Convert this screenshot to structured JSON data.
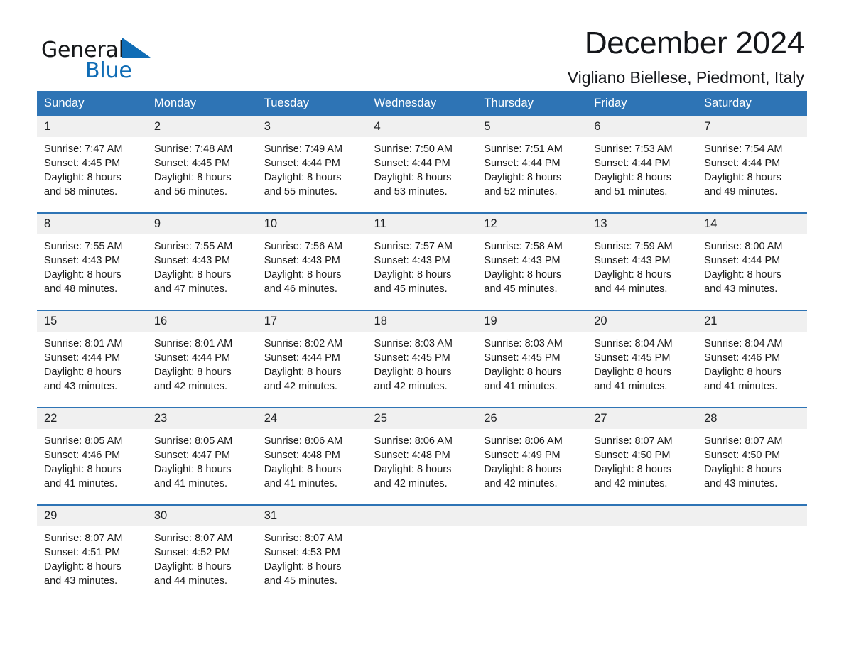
{
  "brand": {
    "name_part1": "General",
    "name_part2": "Blue"
  },
  "header": {
    "month_title": "December 2024",
    "location": "Vigliano Biellese, Piedmont, Italy"
  },
  "colors": {
    "header_blue": "#2e74b5",
    "brand_blue": "#0f6cb5",
    "daynum_strip": "#f0f0f0",
    "text": "#1a1a1a"
  },
  "calendar": {
    "weekday_headers": [
      "Sunday",
      "Monday",
      "Tuesday",
      "Wednesday",
      "Thursday",
      "Friday",
      "Saturday"
    ],
    "weeks": [
      [
        {
          "day": "1",
          "sunrise": "Sunrise: 7:47 AM",
          "sunset": "Sunset: 4:45 PM",
          "daylight_line1": "Daylight: 8 hours",
          "daylight_line2": "and 58 minutes."
        },
        {
          "day": "2",
          "sunrise": "Sunrise: 7:48 AM",
          "sunset": "Sunset: 4:45 PM",
          "daylight_line1": "Daylight: 8 hours",
          "daylight_line2": "and 56 minutes."
        },
        {
          "day": "3",
          "sunrise": "Sunrise: 7:49 AM",
          "sunset": "Sunset: 4:44 PM",
          "daylight_line1": "Daylight: 8 hours",
          "daylight_line2": "and 55 minutes."
        },
        {
          "day": "4",
          "sunrise": "Sunrise: 7:50 AM",
          "sunset": "Sunset: 4:44 PM",
          "daylight_line1": "Daylight: 8 hours",
          "daylight_line2": "and 53 minutes."
        },
        {
          "day": "5",
          "sunrise": "Sunrise: 7:51 AM",
          "sunset": "Sunset: 4:44 PM",
          "daylight_line1": "Daylight: 8 hours",
          "daylight_line2": "and 52 minutes."
        },
        {
          "day": "6",
          "sunrise": "Sunrise: 7:53 AM",
          "sunset": "Sunset: 4:44 PM",
          "daylight_line1": "Daylight: 8 hours",
          "daylight_line2": "and 51 minutes."
        },
        {
          "day": "7",
          "sunrise": "Sunrise: 7:54 AM",
          "sunset": "Sunset: 4:44 PM",
          "daylight_line1": "Daylight: 8 hours",
          "daylight_line2": "and 49 minutes."
        }
      ],
      [
        {
          "day": "8",
          "sunrise": "Sunrise: 7:55 AM",
          "sunset": "Sunset: 4:43 PM",
          "daylight_line1": "Daylight: 8 hours",
          "daylight_line2": "and 48 minutes."
        },
        {
          "day": "9",
          "sunrise": "Sunrise: 7:55 AM",
          "sunset": "Sunset: 4:43 PM",
          "daylight_line1": "Daylight: 8 hours",
          "daylight_line2": "and 47 minutes."
        },
        {
          "day": "10",
          "sunrise": "Sunrise: 7:56 AM",
          "sunset": "Sunset: 4:43 PM",
          "daylight_line1": "Daylight: 8 hours",
          "daylight_line2": "and 46 minutes."
        },
        {
          "day": "11",
          "sunrise": "Sunrise: 7:57 AM",
          "sunset": "Sunset: 4:43 PM",
          "daylight_line1": "Daylight: 8 hours",
          "daylight_line2": "and 45 minutes."
        },
        {
          "day": "12",
          "sunrise": "Sunrise: 7:58 AM",
          "sunset": "Sunset: 4:43 PM",
          "daylight_line1": "Daylight: 8 hours",
          "daylight_line2": "and 45 minutes."
        },
        {
          "day": "13",
          "sunrise": "Sunrise: 7:59 AM",
          "sunset": "Sunset: 4:43 PM",
          "daylight_line1": "Daylight: 8 hours",
          "daylight_line2": "and 44 minutes."
        },
        {
          "day": "14",
          "sunrise": "Sunrise: 8:00 AM",
          "sunset": "Sunset: 4:44 PM",
          "daylight_line1": "Daylight: 8 hours",
          "daylight_line2": "and 43 minutes."
        }
      ],
      [
        {
          "day": "15",
          "sunrise": "Sunrise: 8:01 AM",
          "sunset": "Sunset: 4:44 PM",
          "daylight_line1": "Daylight: 8 hours",
          "daylight_line2": "and 43 minutes."
        },
        {
          "day": "16",
          "sunrise": "Sunrise: 8:01 AM",
          "sunset": "Sunset: 4:44 PM",
          "daylight_line1": "Daylight: 8 hours",
          "daylight_line2": "and 42 minutes."
        },
        {
          "day": "17",
          "sunrise": "Sunrise: 8:02 AM",
          "sunset": "Sunset: 4:44 PM",
          "daylight_line1": "Daylight: 8 hours",
          "daylight_line2": "and 42 minutes."
        },
        {
          "day": "18",
          "sunrise": "Sunrise: 8:03 AM",
          "sunset": "Sunset: 4:45 PM",
          "daylight_line1": "Daylight: 8 hours",
          "daylight_line2": "and 42 minutes."
        },
        {
          "day": "19",
          "sunrise": "Sunrise: 8:03 AM",
          "sunset": "Sunset: 4:45 PM",
          "daylight_line1": "Daylight: 8 hours",
          "daylight_line2": "and 41 minutes."
        },
        {
          "day": "20",
          "sunrise": "Sunrise: 8:04 AM",
          "sunset": "Sunset: 4:45 PM",
          "daylight_line1": "Daylight: 8 hours",
          "daylight_line2": "and 41 minutes."
        },
        {
          "day": "21",
          "sunrise": "Sunrise: 8:04 AM",
          "sunset": "Sunset: 4:46 PM",
          "daylight_line1": "Daylight: 8 hours",
          "daylight_line2": "and 41 minutes."
        }
      ],
      [
        {
          "day": "22",
          "sunrise": "Sunrise: 8:05 AM",
          "sunset": "Sunset: 4:46 PM",
          "daylight_line1": "Daylight: 8 hours",
          "daylight_line2": "and 41 minutes."
        },
        {
          "day": "23",
          "sunrise": "Sunrise: 8:05 AM",
          "sunset": "Sunset: 4:47 PM",
          "daylight_line1": "Daylight: 8 hours",
          "daylight_line2": "and 41 minutes."
        },
        {
          "day": "24",
          "sunrise": "Sunrise: 8:06 AM",
          "sunset": "Sunset: 4:48 PM",
          "daylight_line1": "Daylight: 8 hours",
          "daylight_line2": "and 41 minutes."
        },
        {
          "day": "25",
          "sunrise": "Sunrise: 8:06 AM",
          "sunset": "Sunset: 4:48 PM",
          "daylight_line1": "Daylight: 8 hours",
          "daylight_line2": "and 42 minutes."
        },
        {
          "day": "26",
          "sunrise": "Sunrise: 8:06 AM",
          "sunset": "Sunset: 4:49 PM",
          "daylight_line1": "Daylight: 8 hours",
          "daylight_line2": "and 42 minutes."
        },
        {
          "day": "27",
          "sunrise": "Sunrise: 8:07 AM",
          "sunset": "Sunset: 4:50 PM",
          "daylight_line1": "Daylight: 8 hours",
          "daylight_line2": "and 42 minutes."
        },
        {
          "day": "28",
          "sunrise": "Sunrise: 8:07 AM",
          "sunset": "Sunset: 4:50 PM",
          "daylight_line1": "Daylight: 8 hours",
          "daylight_line2": "and 43 minutes."
        }
      ],
      [
        {
          "day": "29",
          "sunrise": "Sunrise: 8:07 AM",
          "sunset": "Sunset: 4:51 PM",
          "daylight_line1": "Daylight: 8 hours",
          "daylight_line2": "and 43 minutes."
        },
        {
          "day": "30",
          "sunrise": "Sunrise: 8:07 AM",
          "sunset": "Sunset: 4:52 PM",
          "daylight_line1": "Daylight: 8 hours",
          "daylight_line2": "and 44 minutes."
        },
        {
          "day": "31",
          "sunrise": "Sunrise: 8:07 AM",
          "sunset": "Sunset: 4:53 PM",
          "daylight_line1": "Daylight: 8 hours",
          "daylight_line2": "and 45 minutes."
        },
        {
          "day": "",
          "sunrise": "",
          "sunset": "",
          "daylight_line1": "",
          "daylight_line2": ""
        },
        {
          "day": "",
          "sunrise": "",
          "sunset": "",
          "daylight_line1": "",
          "daylight_line2": ""
        },
        {
          "day": "",
          "sunrise": "",
          "sunset": "",
          "daylight_line1": "",
          "daylight_line2": ""
        },
        {
          "day": "",
          "sunrise": "",
          "sunset": "",
          "daylight_line1": "",
          "daylight_line2": ""
        }
      ]
    ]
  }
}
